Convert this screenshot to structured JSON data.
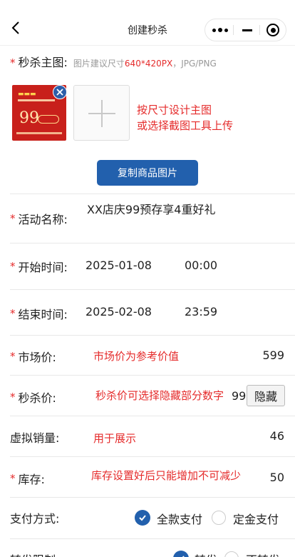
{
  "nav": {
    "title": "创建秒杀"
  },
  "main_image": {
    "label": "秒杀主图:",
    "hint_prefix": "图片建议尺寸",
    "hint_size": "640*420PX",
    "hint_suffix": "，JPG/PNG",
    "tip_line1": "按尺寸设计主图",
    "tip_line2": "或选择截图工具上传",
    "copy_button": "复制商品图片",
    "thumb_text": "99"
  },
  "form": {
    "activity_name": {
      "label": "活动名称:",
      "value": "XX店庆99预存享4重好礼"
    },
    "start_time": {
      "label": "开始时间:",
      "date": "2025-01-08",
      "time": "00:00"
    },
    "end_time": {
      "label": "结束时间:",
      "date": "2025-02-08",
      "time": "23:59"
    },
    "market_price": {
      "label": "市场价:",
      "note": "市场价为参考价值",
      "value": "599"
    },
    "seckill_price": {
      "label": "秒杀价:",
      "note": "秒杀价可选择隐藏部分数字",
      "value": "99",
      "hide_button": "隐藏"
    },
    "virtual_sales": {
      "label": "虚拟销量:",
      "note": "用于展示",
      "value": "46"
    },
    "stock": {
      "label": "库存:",
      "note": "库存设置好后只能增加不可减少",
      "value": "50"
    },
    "payment": {
      "label": "支付方式:",
      "option1": "全款支付",
      "option2": "定金支付",
      "selected": "全款支付"
    },
    "forward": {
      "label": "转发限制:",
      "option1": "转发",
      "option2": "不转发",
      "selected": "转发"
    }
  },
  "colors": {
    "primary": "#2260ad",
    "required": "#e52b2b"
  }
}
